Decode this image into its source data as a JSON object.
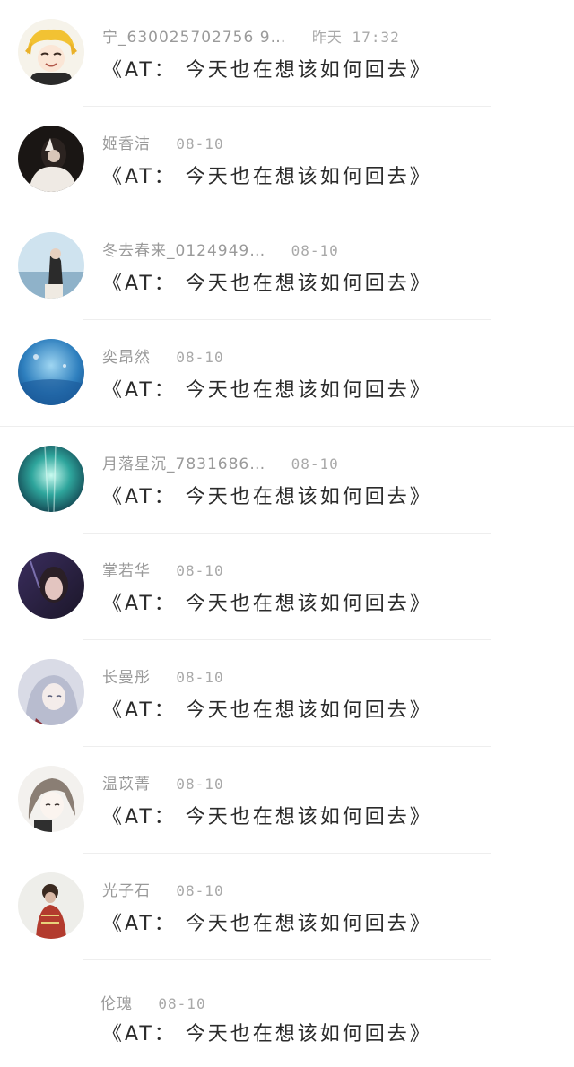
{
  "messages": [
    {
      "name": "宁_630025702756 9…",
      "time": "昨天 17:32",
      "text": "《AT： 今天也在想该如何回去》"
    },
    {
      "name": "姬香洁",
      "time": "08-10",
      "text": "《AT： 今天也在想该如何回去》"
    },
    {
      "name": "冬去春来_0124949…",
      "time": "08-10",
      "text": "《AT： 今天也在想该如何回去》"
    },
    {
      "name": "奕昂然",
      "time": "08-10",
      "text": "《AT： 今天也在想该如何回去》"
    },
    {
      "name": "月落星沉_7831686…",
      "time": "08-10",
      "text": "《AT： 今天也在想该如何回去》"
    },
    {
      "name": "掌若华",
      "time": "08-10",
      "text": "《AT： 今天也在想该如何回去》"
    },
    {
      "name": "长曼彤",
      "time": "08-10",
      "text": "《AT： 今天也在想该如何回去》"
    },
    {
      "name": "温苡菁",
      "time": "08-10",
      "text": "《AT： 今天也在想该如何回去》"
    },
    {
      "name": "光子石",
      "time": "08-10",
      "text": "《AT： 今天也在想该如何回去》"
    },
    {
      "name": "伦瑰",
      "time": "08-10",
      "text": "《AT： 今天也在想该如何回去》"
    }
  ]
}
